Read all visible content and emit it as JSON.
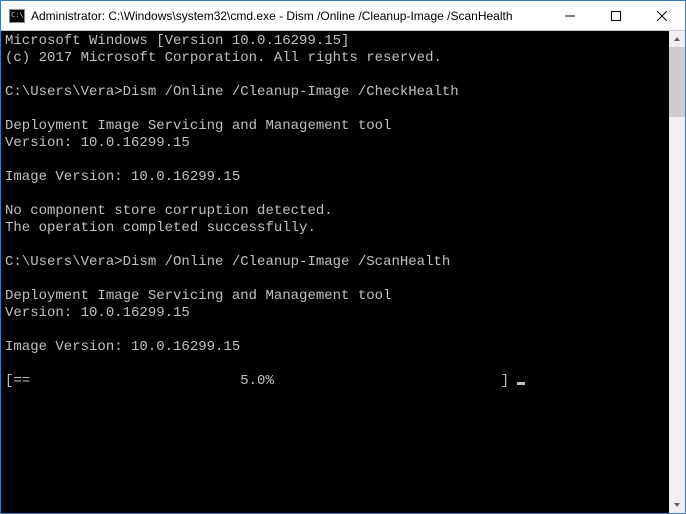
{
  "titlebar": {
    "title": "Administrator: C:\\Windows\\system32\\cmd.exe - Dism  /Online /Cleanup-Image /ScanHealth"
  },
  "console": {
    "lines": {
      "l0": "Microsoft Windows [Version 10.0.16299.15]",
      "l1": "(c) 2017 Microsoft Corporation. All rights reserved.",
      "l2": "",
      "l3_prompt": "C:\\Users\\Vera>",
      "l3_cmd": "Dism /Online /Cleanup-Image /CheckHealth",
      "l4": "",
      "l5": "Deployment Image Servicing and Management tool",
      "l6": "Version: 10.0.16299.15",
      "l7": "",
      "l8": "Image Version: 10.0.16299.15",
      "l9": "",
      "l10": "No component store corruption detected.",
      "l11": "The operation completed successfully.",
      "l12": "",
      "l13_prompt": "C:\\Users\\Vera>",
      "l13_cmd": "Dism /Online /Cleanup-Image /ScanHealth",
      "l14": "",
      "l15": "Deployment Image Servicing and Management tool",
      "l16": "Version: 10.0.16299.15",
      "l17": "",
      "l18": "Image Version: 10.0.16299.15",
      "l19": "",
      "progress_line": "[==                         5.0%                           ] "
    }
  },
  "icons": {
    "cmd": "cmd-icon",
    "minimize": "minimize-icon",
    "maximize": "maximize-icon",
    "close": "close-icon",
    "scroll_up": "scroll-up-icon",
    "scroll_down": "scroll-down-icon"
  },
  "colors": {
    "text": "#c0c0c0",
    "bg": "#000000",
    "titlebar": "#ffffff"
  }
}
